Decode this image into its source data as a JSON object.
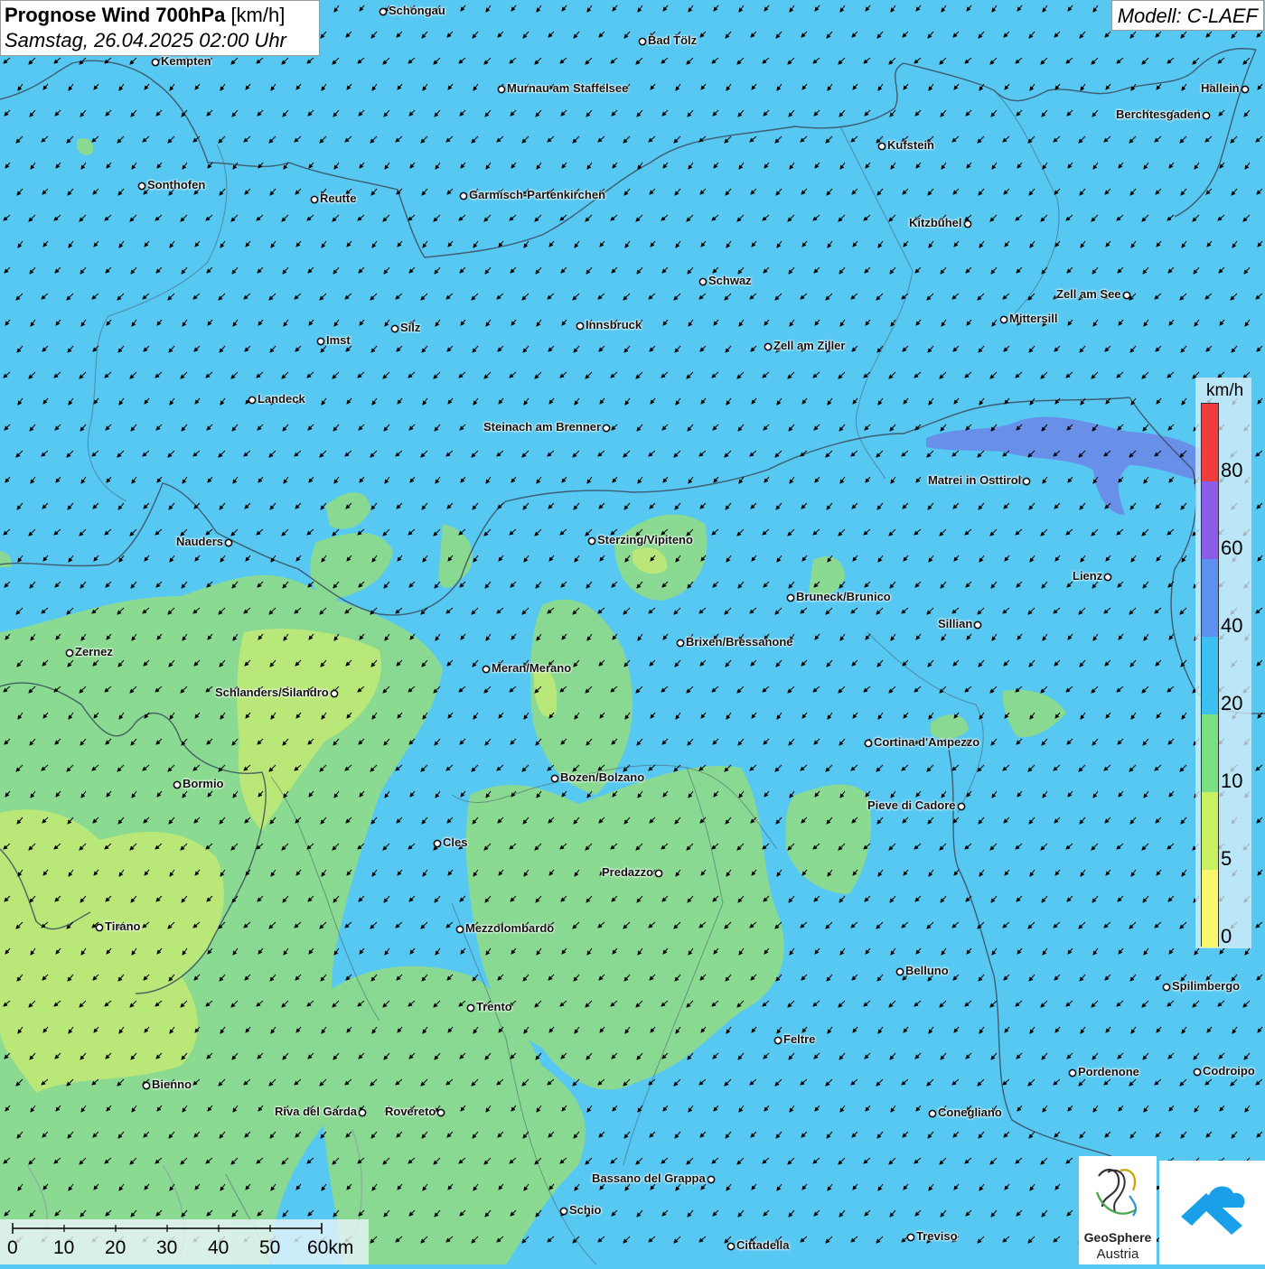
{
  "title": {
    "main": "Prognose Wind 700hPa",
    "unit": "[km/h]",
    "datetime": "Samstag, 26.04.2025 02:00 Uhr"
  },
  "model": "Modell: C-LAEF",
  "legend": {
    "unit": "km/h",
    "labels": [
      "80",
      "60",
      "40",
      "20",
      "10",
      "5",
      "0"
    ],
    "colors": {
      "80_plus": "#f03c3c",
      "60_80": "#8a5ce8",
      "40_60": "#5c92ee",
      "20_40": "#3cc0f0",
      "10_20": "#7ae082",
      "5_10": "#c8f060",
      "0_5": "#f8f870"
    }
  },
  "scale_bar": {
    "labels": [
      "0",
      "10",
      "20",
      "30",
      "40",
      "50",
      "60km"
    ]
  },
  "wind_direction": "northeasterly (arrows pointing toward south-west)",
  "cities": [
    {
      "name": "Schongau"
    },
    {
      "name": "Bad Tölz"
    },
    {
      "name": "Kempten"
    },
    {
      "name": "Murnau am Staffelsee"
    },
    {
      "name": "Hallein"
    },
    {
      "name": "Berchtesgaden"
    },
    {
      "name": "Kufstein"
    },
    {
      "name": "Sonthofen"
    },
    {
      "name": "Reutte"
    },
    {
      "name": "Garmisch-Partenkirchen"
    },
    {
      "name": "Kitzbühel"
    },
    {
      "name": "Schwaz"
    },
    {
      "name": "Zell am See"
    },
    {
      "name": "Mittersill"
    },
    {
      "name": "Imst"
    },
    {
      "name": "Silz"
    },
    {
      "name": "Innsbruck"
    },
    {
      "name": "Zell am Ziller"
    },
    {
      "name": "Landeck"
    },
    {
      "name": "Steinach am Brenner"
    },
    {
      "name": "Matrei in Osttirol"
    },
    {
      "name": "Nauders"
    },
    {
      "name": "Sterzing/Vipiteno"
    },
    {
      "name": "Lienz"
    },
    {
      "name": "Bruneck/Brunico"
    },
    {
      "name": "Sillian"
    },
    {
      "name": "Zernez"
    },
    {
      "name": "Brixen/Bressanone"
    },
    {
      "name": "Meran/Merano"
    },
    {
      "name": "Schlanders/Silandro"
    },
    {
      "name": "Cortina d'Ampezzo"
    },
    {
      "name": "Bozen/Bolzano"
    },
    {
      "name": "Bormio"
    },
    {
      "name": "Pieve di Cadore"
    },
    {
      "name": "Cles"
    },
    {
      "name": "Predazzo"
    },
    {
      "name": "Tirano"
    },
    {
      "name": "Mezzolombardo"
    },
    {
      "name": "Belluno"
    },
    {
      "name": "Spilimbergo"
    },
    {
      "name": "Trento"
    },
    {
      "name": "Feltre"
    },
    {
      "name": "Pordenone"
    },
    {
      "name": "Codroipo"
    },
    {
      "name": "Bienno"
    },
    {
      "name": "Riva del Garda"
    },
    {
      "name": "Rovereto"
    },
    {
      "name": "Conegliano"
    },
    {
      "name": "Bassano del Grappa"
    },
    {
      "name": "Schio"
    },
    {
      "name": "Treviso"
    },
    {
      "name": "Cittadella"
    }
  ],
  "logos": {
    "geosphere_line1": "GeoSphere",
    "geosphere_line2": "Austria"
  }
}
